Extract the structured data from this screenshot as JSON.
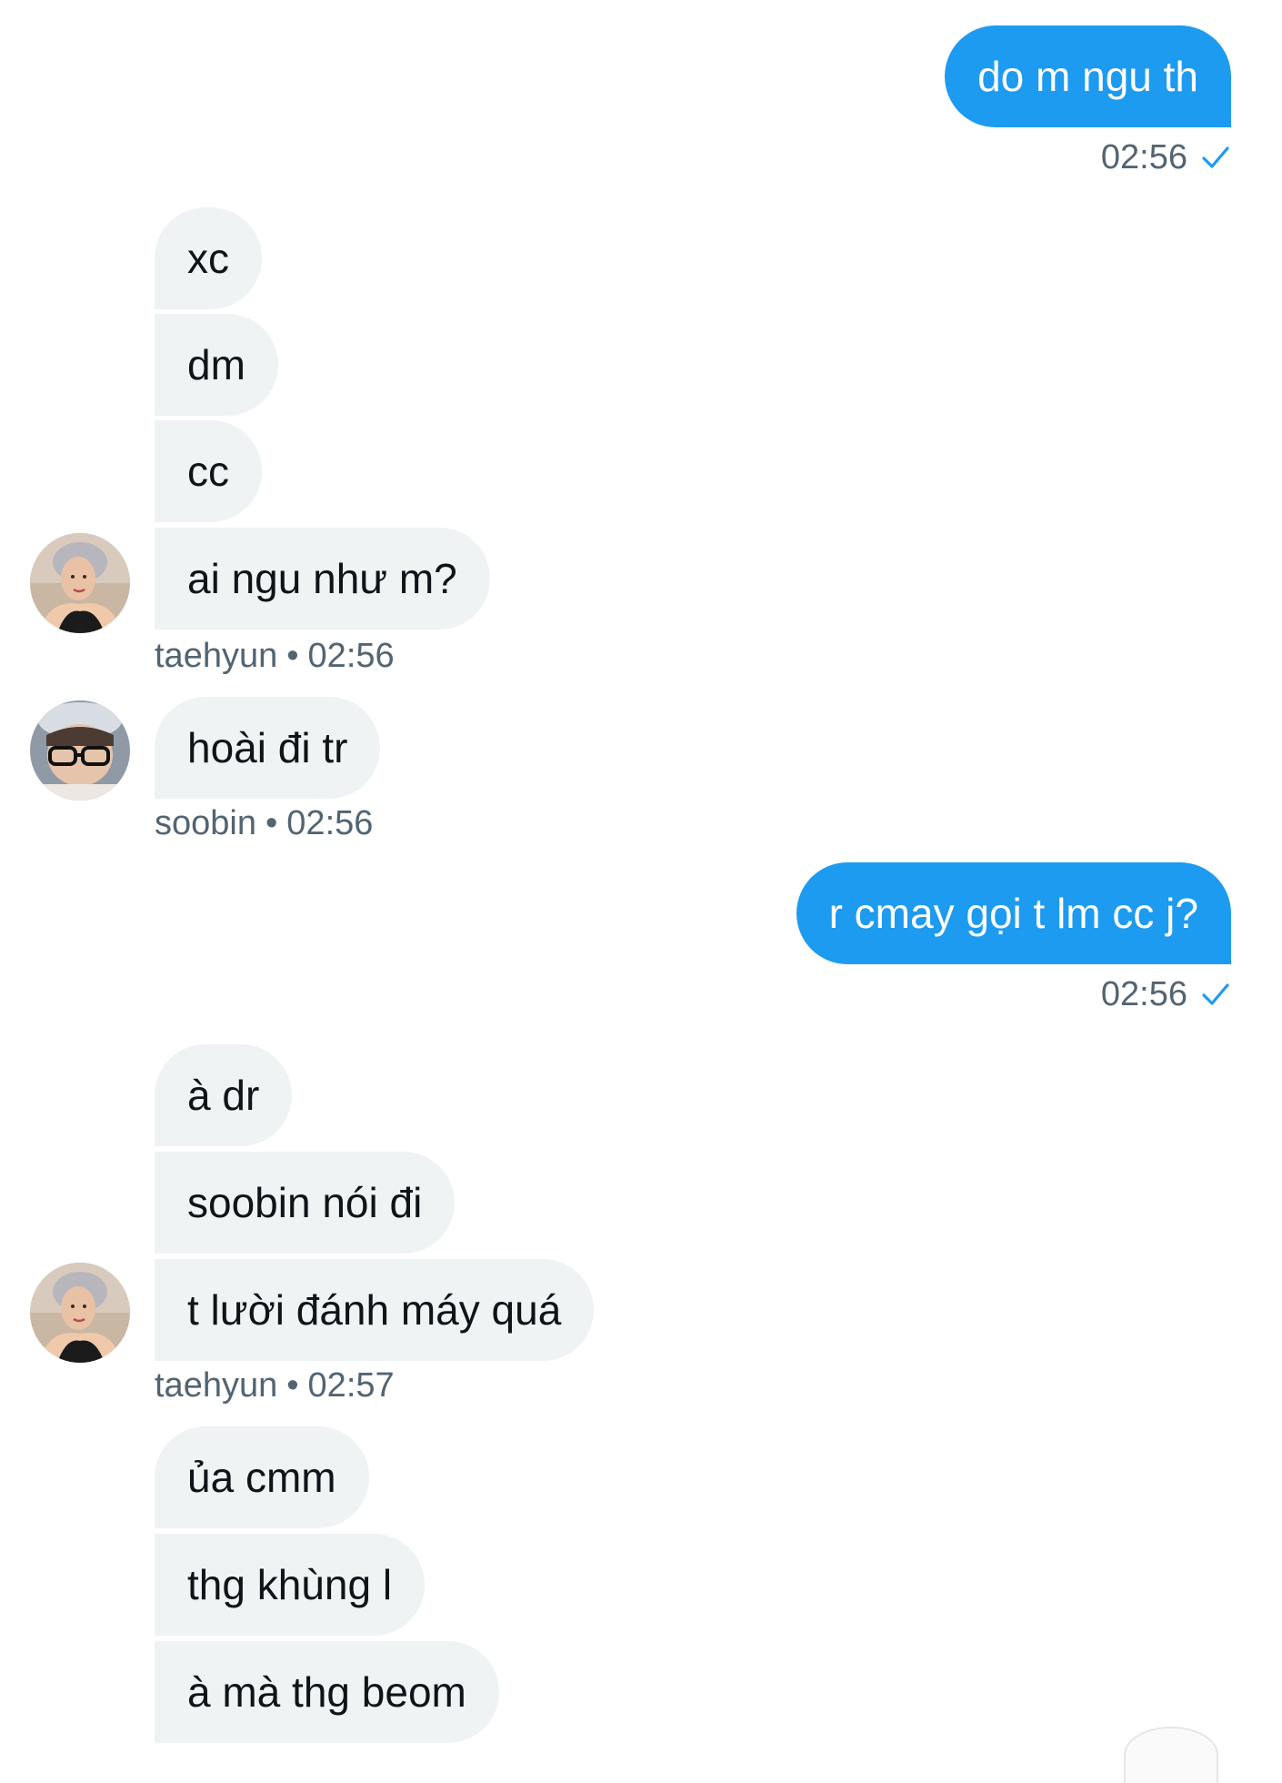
{
  "messages": [
    {
      "text": "do m ngu th",
      "time": "02:56",
      "status_icon": "check-icon"
    },
    {
      "text": "xc"
    },
    {
      "text": "dm"
    },
    {
      "text": "cc"
    },
    {
      "text": "ai ngu như m?"
    },
    {
      "sender": "taehyun",
      "time": "02:56"
    },
    {
      "text": "hoài đi tr"
    },
    {
      "sender": "soobin",
      "time": "02:56"
    },
    {
      "text": "r cmay gọi t lm cc j?",
      "time": "02:56",
      "status_icon": "check-icon"
    },
    {
      "text": "à dr"
    },
    {
      "text": "soobin nói đi"
    },
    {
      "text": "t lười đánh máy quá"
    },
    {
      "sender": "taehyun",
      "time": "02:57"
    },
    {
      "text": "ủa cmm"
    },
    {
      "text": "thg khùng l"
    },
    {
      "text": "à mà thg beom"
    }
  ],
  "separator": "•",
  "colors": {
    "outgoing_bubble": "#1d9bf0",
    "incoming_bubble": "#eff3f4",
    "meta_text": "#536471",
    "check": "#1d9bf0"
  }
}
